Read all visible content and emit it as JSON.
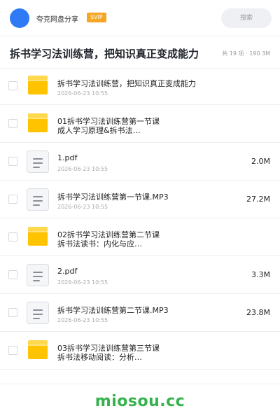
{
  "header": {
    "share_label": "夸克网盘分享",
    "badge": "SVIP",
    "search_placeholder": "搜索"
  },
  "folder": {
    "title": "拆书学习法训练营，把知识真正变成能力",
    "meta": "共 19 项 · 190.3M"
  },
  "files": [
    {
      "type": "folder",
      "name": "拆书学习法训练营，把知识真正变成能力",
      "subtitle": "",
      "date": "2026-06-23 10:55",
      "size": ""
    },
    {
      "type": "folder",
      "name": "01拆书学习法训练营第一节课",
      "subtitle": "成人学习原理&拆书法…",
      "date": "",
      "size": ""
    },
    {
      "type": "file",
      "name": "1.pdf",
      "subtitle": "",
      "date": "2026-06-23 10:55",
      "size": "2.0M"
    },
    {
      "type": "file",
      "name": "拆书学习法训练营第一节课.MP3",
      "subtitle": "",
      "date": "2026-06-23 10:55",
      "size": "27.2M"
    },
    {
      "type": "folder",
      "name": "02拆书学习法训练营第二节课",
      "subtitle": "拆书法读书：内化与应…",
      "date": "",
      "size": ""
    },
    {
      "type": "file",
      "name": "2.pdf",
      "subtitle": "",
      "date": "2026-06-23 10:55",
      "size": "3.3M"
    },
    {
      "type": "file",
      "name": "拆书学习法训练营第二节课.MP3",
      "subtitle": "",
      "date": "2026-06-23 10:55",
      "size": "23.8M"
    },
    {
      "type": "folder",
      "name": "03拆书学习法训练营第三节课",
      "subtitle": "拆书法移动阅读：分析…",
      "date": "",
      "size": ""
    }
  ],
  "footer": {
    "watermark": "miosou.cc"
  },
  "colors": {
    "accent": "#2f7bf6",
    "svip": "#f5a623",
    "folder": "#ffc300",
    "watermark": "#35b24b"
  }
}
